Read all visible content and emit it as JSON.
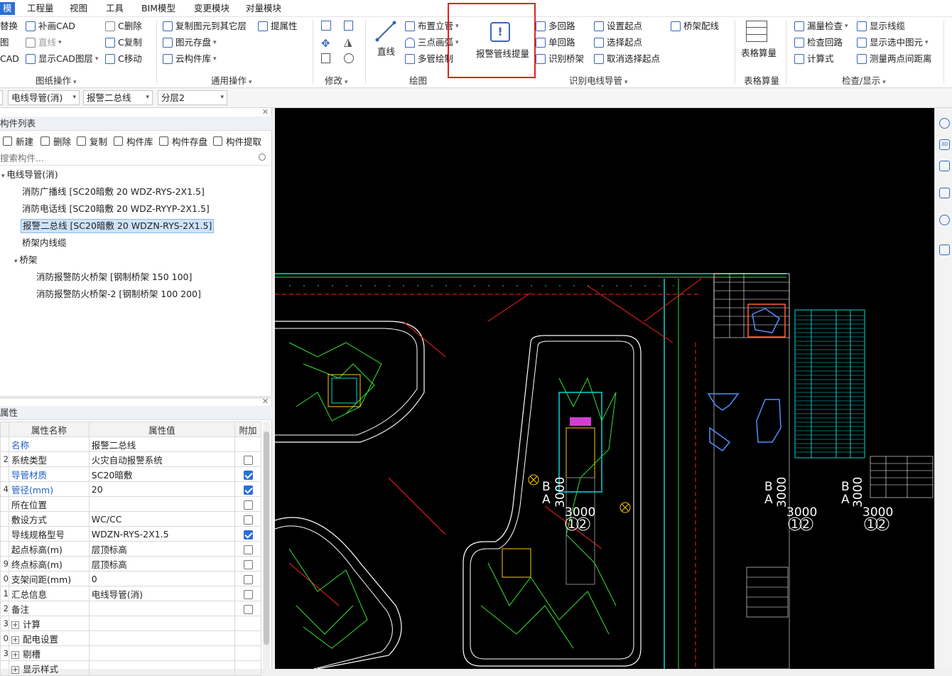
{
  "menu": {
    "items": [
      "模",
      "工程量",
      "视图",
      "工具",
      "BIM模型",
      "变更模块",
      "对量模块"
    ]
  },
  "ribbon": {
    "drawing_ops": {
      "label": "图纸操作",
      "items": [
        "替换",
        "补画CAD",
        "C删除",
        "图",
        "直线",
        "C复制",
        "CAD",
        "显示CAD图层",
        "C移动"
      ]
    },
    "common_ops": {
      "label": "通用操作",
      "items": [
        "复制图元到其它层",
        "提属性",
        "图元存盘",
        "云构件库"
      ]
    },
    "modify": {
      "label": "修改"
    },
    "draw": {
      "label": "绘图",
      "items": [
        "直线",
        "布置立管",
        "三点画弧",
        "多管绘制"
      ]
    },
    "alarm_button": "报警管线提量",
    "identify": {
      "label": "识别电线导管",
      "items": [
        "多回路",
        "设置起点",
        "桥架配线",
        "单回路",
        "选择起点",
        "识别桥架",
        "取消选择起点"
      ]
    },
    "table_calc": {
      "label": "表格算量",
      "button": "表格算量"
    },
    "check": {
      "label": "检查/显示",
      "items": [
        "漏量检查",
        "显示线缆",
        "检查回路",
        "显示选中图元",
        "计算式",
        "测量两点间距离"
      ]
    }
  },
  "toolbar2": {
    "combo1": "电线导管(消)",
    "combo2": "报警二总线",
    "combo3": "分层2"
  },
  "component_list": {
    "title": "构件列表",
    "buttons": [
      "新建",
      "删除",
      "复制",
      "构件库",
      "构件存盘",
      "构件提取"
    ],
    "search_placeholder": "搜索构件...",
    "tree": {
      "root": "电线导管(消)",
      "children": [
        "消防广播线 [SC20暗敷 20 WDZ-RYS-2X1.5]",
        "消防电话线 [SC20暗敷 20 WDZ-RYYP-2X1.5]",
        "报警二总线 [SC20暗敷 20 WDZN-RYS-2X1.5]",
        "桥架内线缆"
      ],
      "tray_group": "桥架",
      "tray_children": [
        "消防报警防火桥架 [钢制桥架 150 100]",
        "消防报警防火桥架-2 [钢制桥架 100 200]"
      ]
    }
  },
  "properties": {
    "title": "属性",
    "headers": [
      "属性名称",
      "属性值",
      "附加"
    ],
    "rows": [
      {
        "num": "",
        "name": "名称",
        "value": "报警二总线",
        "blue": true,
        "check": null
      },
      {
        "num": "2",
        "name": "系统类型",
        "value": "火灾自动报警系统",
        "blue": false,
        "check": false
      },
      {
        "num": "",
        "name": "导管材质",
        "value": "SC20暗敷",
        "blue": true,
        "check": true
      },
      {
        "num": "4",
        "name": "管径(mm)",
        "value": "20",
        "blue": true,
        "check": true
      },
      {
        "num": "",
        "name": "所在位置",
        "value": "",
        "blue": false,
        "check": false
      },
      {
        "num": "",
        "name": "敷设方式",
        "value": "WC/CC",
        "blue": false,
        "check": false
      },
      {
        "num": "",
        "name": "导线规格型号",
        "value": "WDZN-RYS-2X1.5",
        "blue": false,
        "check": true
      },
      {
        "num": "",
        "name": "起点标高(m)",
        "value": "层顶标高",
        "blue": false,
        "check": false
      },
      {
        "num": "9",
        "name": "终点标高(m)",
        "value": "层顶标高",
        "blue": false,
        "check": false
      },
      {
        "num": "0",
        "name": "支架间距(mm)",
        "value": "0",
        "blue": false,
        "check": false
      },
      {
        "num": "1",
        "name": "汇总信息",
        "value": "电线导管(消)",
        "blue": false,
        "check": false
      },
      {
        "num": "2",
        "name": "备注",
        "value": "",
        "blue": false,
        "check": false
      },
      {
        "num": "3",
        "name": "计算",
        "value": "",
        "blue": false,
        "check": null,
        "expand": true
      },
      {
        "num": "0",
        "name": "配电设置",
        "value": "",
        "blue": false,
        "check": null,
        "expand": true
      },
      {
        "num": "3",
        "name": "剔槽",
        "value": "",
        "blue": false,
        "check": null,
        "expand": true
      },
      {
        "num": "",
        "name": "显示样式",
        "value": "",
        "blue": false,
        "check": null,
        "expand": true
      }
    ]
  },
  "canvas": {
    "axis_labels": [
      {
        "text": "B",
        "id": "b1"
      },
      {
        "text": "A",
        "id": "a1"
      },
      {
        "text": "3000",
        "id": "v1"
      },
      {
        "text": "3000",
        "id": "h1"
      },
      {
        "text": "1",
        "id": "n1a"
      },
      {
        "text": "2",
        "id": "n1b"
      },
      {
        "text": "B",
        "id": "b2"
      },
      {
        "text": "A",
        "id": "a2"
      },
      {
        "text": "3000",
        "id": "v2"
      },
      {
        "text": "3000",
        "id": "h2"
      },
      {
        "text": "1",
        "id": "n2a"
      },
      {
        "text": "2",
        "id": "n2b"
      },
      {
        "text": "B",
        "id": "b3"
      },
      {
        "text": "A",
        "id": "a3"
      },
      {
        "text": "3000",
        "id": "v3"
      },
      {
        "text": "3000",
        "id": "h3"
      },
      {
        "text": "1",
        "id": "n3a"
      },
      {
        "text": "2",
        "id": "n3b"
      }
    ]
  },
  "colors": {
    "accent": "#2b6fd6",
    "highlight_box": "#e02020",
    "cad_bg": "#000000",
    "cad_green": "#35e035",
    "cad_cyan": "#00d8d8",
    "cad_red": "#ff2020"
  }
}
